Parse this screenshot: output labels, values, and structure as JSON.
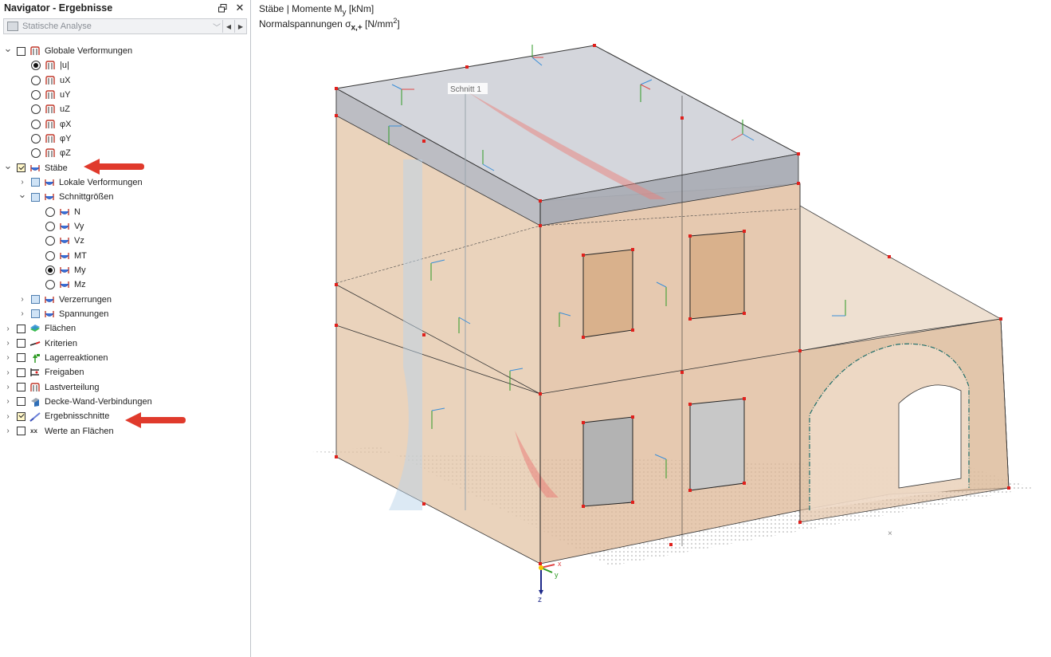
{
  "navigator": {
    "title": "Navigator - Ergebnisse",
    "combo": {
      "value": "Statische Analyse"
    },
    "items": [
      {
        "label": "Globale Verformungen",
        "level": 0,
        "kind": "checkbox",
        "state": "unchecked",
        "expander": "open",
        "icon": "deformation-icon"
      },
      {
        "label": "|u|",
        "level": 1,
        "kind": "radio",
        "state": "on",
        "icon": "deformation-icon"
      },
      {
        "label": "uX",
        "level": 1,
        "kind": "radio",
        "state": "off",
        "icon": "deformation-icon"
      },
      {
        "label": "uY",
        "level": 1,
        "kind": "radio",
        "state": "off",
        "icon": "deformation-icon"
      },
      {
        "label": "uZ",
        "level": 1,
        "kind": "radio",
        "state": "off",
        "icon": "deformation-icon"
      },
      {
        "label": "φX",
        "level": 1,
        "kind": "radio",
        "state": "off",
        "icon": "deformation-icon"
      },
      {
        "label": "φY",
        "level": 1,
        "kind": "radio",
        "state": "off",
        "icon": "deformation-icon"
      },
      {
        "label": "φZ",
        "level": 1,
        "kind": "radio",
        "state": "off",
        "icon": "deformation-icon"
      },
      {
        "label": "Stäbe",
        "level": 0,
        "kind": "checkbox",
        "state": "checked",
        "expander": "open",
        "icon": "member-icon"
      },
      {
        "label": "Lokale Verformungen",
        "level": 1,
        "kind": "checkbox",
        "state": "partial",
        "expander": "closed",
        "icon": "member-icon"
      },
      {
        "label": "Schnittgrößen",
        "level": 1,
        "kind": "checkbox",
        "state": "partial",
        "expander": "open",
        "icon": "member-icon"
      },
      {
        "label": "N",
        "level": 2,
        "kind": "radio",
        "state": "off",
        "icon": "member-icon"
      },
      {
        "label": "Vy",
        "level": 2,
        "kind": "radio",
        "state": "off",
        "icon": "member-icon"
      },
      {
        "label": "Vz",
        "level": 2,
        "kind": "radio",
        "state": "off",
        "icon": "member-icon"
      },
      {
        "label": "MT",
        "level": 2,
        "kind": "radio",
        "state": "off",
        "icon": "member-icon"
      },
      {
        "label": "My",
        "level": 2,
        "kind": "radio",
        "state": "on",
        "icon": "member-icon"
      },
      {
        "label": "Mz",
        "level": 2,
        "kind": "radio",
        "state": "off",
        "icon": "member-icon"
      },
      {
        "label": "Verzerrungen",
        "level": 1,
        "kind": "checkbox",
        "state": "partial",
        "expander": "closed",
        "icon": "member-icon"
      },
      {
        "label": "Spannungen",
        "level": 1,
        "kind": "checkbox",
        "state": "partial",
        "expander": "closed",
        "icon": "member-icon"
      },
      {
        "label": "Flächen",
        "level": 0,
        "kind": "checkbox",
        "state": "unchecked",
        "expander": "closed",
        "icon": "surfaces-icon"
      },
      {
        "label": "Kriterien",
        "level": 0,
        "kind": "checkbox",
        "state": "unchecked",
        "expander": "closed",
        "icon": "criteria-icon"
      },
      {
        "label": "Lagerreaktionen",
        "level": 0,
        "kind": "checkbox",
        "state": "unchecked",
        "expander": "closed",
        "icon": "support-reactions-icon"
      },
      {
        "label": "Freigaben",
        "level": 0,
        "kind": "checkbox",
        "state": "unchecked",
        "expander": "closed",
        "icon": "releases-icon"
      },
      {
        "label": "Lastverteilung",
        "level": 0,
        "kind": "checkbox",
        "state": "unchecked",
        "expander": "closed",
        "icon": "deformation-icon"
      },
      {
        "label": "Decke-Wand-Verbindungen",
        "level": 0,
        "kind": "checkbox",
        "state": "unchecked",
        "expander": "closed",
        "icon": "slab-wall-icon"
      },
      {
        "label": "Ergebnisschnitte",
        "level": 0,
        "kind": "checkbox",
        "state": "checked",
        "expander": "closed",
        "icon": "result-section-icon"
      },
      {
        "label": "Werte an Flächen",
        "level": 0,
        "kind": "checkbox",
        "state": "unchecked",
        "expander": "closed",
        "icon": "values-on-surfaces-icon"
      }
    ]
  },
  "viewport": {
    "line1": {
      "pre": "Stäbe | Momente M",
      "sub": "y",
      "post": " [kNm]"
    },
    "line2": {
      "pre": "Normalspannungen σ",
      "sub": "x,+",
      "post": " [N/mm",
      "sup": "2",
      "end": "]"
    },
    "section_label": "Schnitt 1",
    "axis_labels": {
      "y": "y",
      "z": "z",
      "x": "x"
    }
  },
  "colors": {
    "wall": "#e3c4a5",
    "slab": "#cfd2d8",
    "node": "#e0201c",
    "arrow": "#e03a2c",
    "axis_y": "#2e9a24",
    "axis_z": "#3a8ed8",
    "axis_x": "#e04848"
  }
}
